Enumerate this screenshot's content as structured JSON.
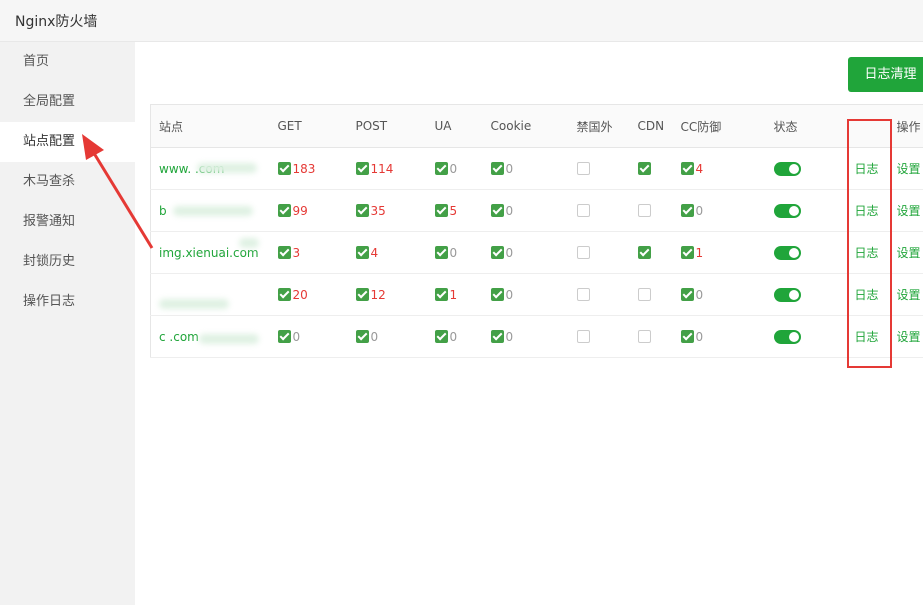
{
  "app": {
    "title": "Nginx防火墙"
  },
  "sidebar": {
    "items": [
      {
        "label": "首页"
      },
      {
        "label": "全局配置"
      },
      {
        "label": "站点配置"
      },
      {
        "label": "木马查杀"
      },
      {
        "label": "报警通知"
      },
      {
        "label": "封锁历史"
      },
      {
        "label": "操作日志"
      }
    ],
    "active_index": 2
  },
  "toolbar": {
    "log_clear_label": "日志清理"
  },
  "table": {
    "headers": [
      "站点",
      "GET",
      "POST",
      "UA",
      "Cookie",
      "禁国外",
      "CDN",
      "CC防御",
      "状态",
      "",
      "操作"
    ],
    "rows": [
      {
        "site": "www.        .com",
        "get": "183",
        "post": "114",
        "ua": "0",
        "cookie": "0",
        "foreign": false,
        "cdn": true,
        "cc": "4",
        "log": "日志",
        "settings": "设置"
      },
      {
        "site": "b",
        "get": "99",
        "post": "35",
        "ua": "5",
        "cookie": "0",
        "foreign": false,
        "cdn": false,
        "cc": "0",
        "log": "日志",
        "settings": "设置"
      },
      {
        "site": "img.xienuai.com",
        "get": "3",
        "post": "4",
        "ua": "0",
        "cookie": "0",
        "foreign": false,
        "cdn": true,
        "cc": "1",
        "log": "日志",
        "settings": "设置"
      },
      {
        "site": "",
        "get": "20",
        "post": "12",
        "ua": "1",
        "cookie": "0",
        "foreign": false,
        "cdn": false,
        "cc": "0",
        "log": "日志",
        "settings": "设置"
      },
      {
        "site": "c          .com",
        "get": "0",
        "post": "0",
        "ua": "0",
        "cookie": "0",
        "foreign": false,
        "cdn": false,
        "cc": "0",
        "log": "日志",
        "settings": "设置"
      }
    ]
  },
  "colors": {
    "accent": "#20a53a",
    "alert": "#e53935",
    "annotation": "#e53935"
  },
  "icons": {
    "checkbox_on": "check-icon",
    "checkbox_off": "empty-checkbox-icon",
    "toggle": "toggle-switch-icon"
  }
}
